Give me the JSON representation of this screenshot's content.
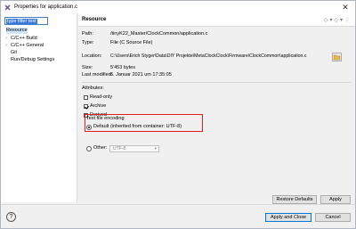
{
  "window": {
    "title": "Properties for application.c",
    "close_glyph": "✕"
  },
  "left_panel": {
    "filter_text": "type filter text",
    "items": [
      {
        "label": "Resource",
        "expandable": false,
        "selected": true
      },
      {
        "label": "C/C++ Build",
        "expandable": true,
        "selected": false
      },
      {
        "label": "C/C++ General",
        "expandable": true,
        "selected": false
      },
      {
        "label": "Git",
        "expandable": false,
        "selected": false
      },
      {
        "label": "Run/Debug Settings",
        "expandable": false,
        "selected": false
      }
    ],
    "chevron_glyph": "›"
  },
  "resource": {
    "heading": "Resource",
    "nav_icons": [
      "◇",
      "▾",
      "◇",
      "▾",
      "⋮"
    ],
    "path_label": "Path:",
    "path_value": "/tinyK22_Master/ClockCommon/application.c",
    "type_label": "Type:",
    "type_value": "File  (C Source File)",
    "location_label": "Location:",
    "location_value": "C:\\Users\\Erich Styger\\Data\\DIY Projekte\\MetaClockClock\\Firmware\\ClockCommon\\application.c",
    "size_label": "Size:",
    "size_value": "5'453  bytes",
    "modified_label": "Last modified:",
    "modified_value": "6. Januar 2021 um 17:35:05",
    "attributes_label": "Attributes:",
    "attributes": [
      {
        "label": "Read-only",
        "checked": false
      },
      {
        "label": "Archive",
        "checked": true
      },
      {
        "label": "Derived",
        "checked": false
      }
    ],
    "encoding_label": "Text file encoding",
    "default_option": "Default (inherited from container: UTF-8)",
    "other_option": "Other:",
    "other_value": "UTF-8",
    "combo_arrow": "▾"
  },
  "buttons": {
    "restore_defaults": "Restore Defaults",
    "apply": "Apply",
    "apply_and_close": "Apply and Close",
    "cancel": "Cancel",
    "help_glyph": "?"
  },
  "colors": {
    "highlight_box": "#e02020",
    "selection": "#cfe5fb",
    "primary_border": "#0078d7"
  }
}
